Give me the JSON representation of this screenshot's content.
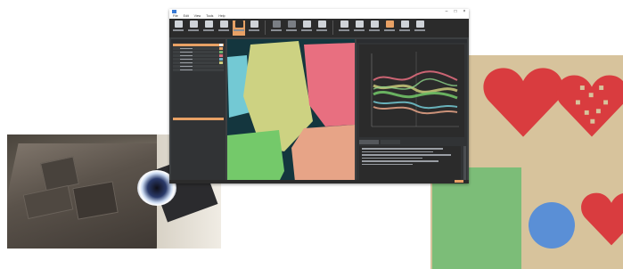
{
  "window": {
    "title": "",
    "menu": [
      "File",
      "Edit",
      "View",
      "Tools",
      "Help"
    ],
    "controls": [
      "–",
      "□",
      "×"
    ]
  },
  "toolbar": {
    "buttons": [
      {
        "icon": "new-project-icon"
      },
      {
        "icon": "open-icon"
      },
      {
        "icon": "save-icon"
      },
      {
        "icon": "close-icon"
      },
      {
        "icon": "select-icon"
      },
      {
        "icon": "pen-icon"
      },
      {
        "icon": "brush-icon"
      },
      {
        "icon": "fill-icon"
      },
      {
        "icon": "erase-icon"
      },
      {
        "icon": "zoom-icon"
      },
      {
        "icon": "cut-icon"
      },
      {
        "icon": "undo-icon"
      },
      {
        "icon": "redo-icon"
      },
      {
        "icon": "layers-icon"
      },
      {
        "icon": "export-icon"
      },
      {
        "icon": "settings-icon"
      }
    ]
  },
  "left_panel": {
    "layers": [
      {
        "swatch": "#9a9ea4"
      },
      {
        "swatch": "#e8a165"
      },
      {
        "swatch": "#6fb26f"
      },
      {
        "swatch": "#d96b7a"
      },
      {
        "swatch": "#6fb2c4"
      },
      {
        "swatch": "#c9c97a"
      },
      {
        "swatch": "#9a9ea4"
      },
      {
        "swatch": "#9a9ea4"
      }
    ]
  },
  "colors": {
    "accent": "#e8a165",
    "window_bg": "#3c3f41",
    "canvas_bg": "#14363e",
    "seg_yellow": "#cdd282",
    "seg_pink": "#e86f80",
    "seg_cyan": "#73c9d4",
    "seg_green": "#74c96a",
    "seg_peach": "#e7a487",
    "heart_red": "#d93c3f",
    "paper": "#d7c39c"
  }
}
